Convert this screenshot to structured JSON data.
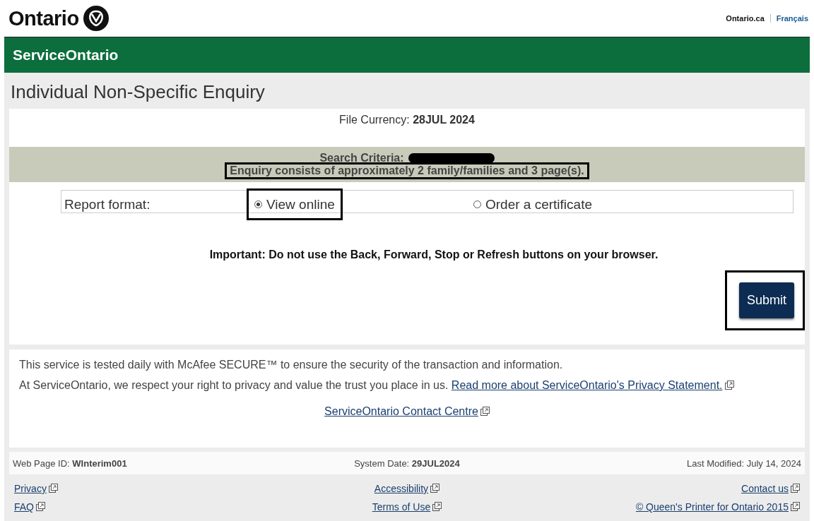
{
  "header": {
    "logo": "Ontario",
    "links": [
      "Ontario.ca",
      "Français"
    ],
    "banner": "ServiceOntario"
  },
  "page_title": "Individual Non-Specific Enquiry",
  "file_currency": {
    "label": "File Currency:",
    "value": "28JUL 2024"
  },
  "search": {
    "label": "Search Criteria:",
    "value_redacted": true,
    "summary": "Enquiry consists of approximately 2 family/families and 3 page(s).",
    "summary_highlighted": true
  },
  "report_format": {
    "label": "Report format:",
    "options": [
      {
        "label": "View online",
        "selected": true,
        "highlighted": true
      },
      {
        "label": "Order a certificate",
        "selected": false,
        "highlighted": false
      }
    ]
  },
  "warning": "Important: Do not use the Back, Forward, Stop or Refresh buttons on your browser.",
  "submit": {
    "label": "Submit",
    "highlighted": true
  },
  "notice": {
    "security": "This service is tested daily with McAfee SECURE™ to ensure the security of the transaction and information.",
    "privacy": "At ServiceOntario, we respect your right to privacy and value the trust you place in us.",
    "privacy_link": "Read more about ServiceOntario's Privacy Statement.",
    "contact_link": "ServiceOntario Contact Centre"
  },
  "info": [
    {
      "label": "Web Page ID:",
      "value": "WInterim001"
    },
    {
      "label": "System Date:",
      "value": "29JUL2024"
    },
    {
      "label": "Last Modified: July 14, 2024"
    }
  ],
  "footer_links": [
    "Privacy",
    "Accessibility",
    "Contact us",
    "FAQ",
    "Terms of Use",
    "© Queen's Printer for Ontario 2015"
  ]
}
